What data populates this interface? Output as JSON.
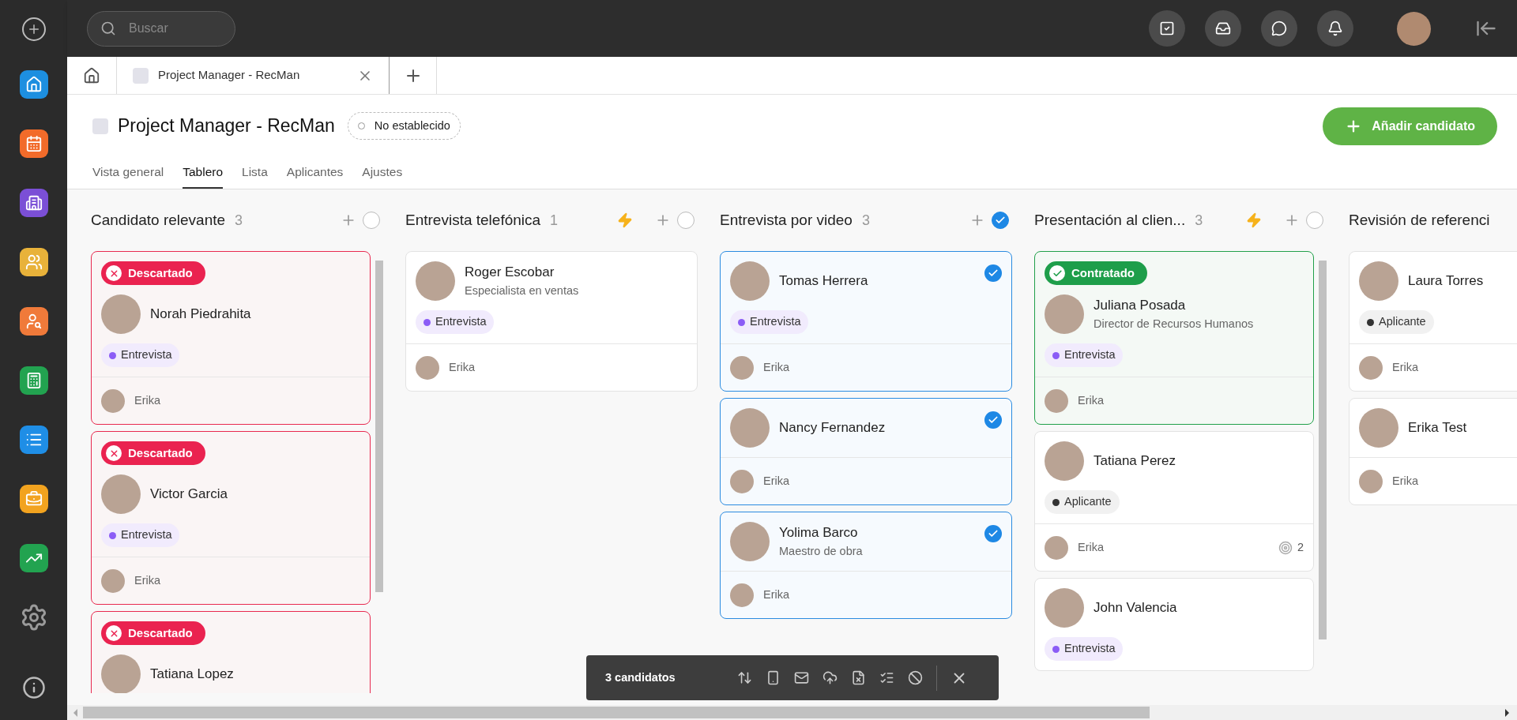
{
  "search": {
    "placeholder": "Buscar"
  },
  "doc_tabs": [
    {
      "label": "Project Manager - RecMan",
      "selected": true
    }
  ],
  "page": {
    "title": "Project Manager - RecMan",
    "status": "No establecido",
    "add_button": "Añadir candidato"
  },
  "tabs": [
    {
      "label": "Vista general",
      "selected": false
    },
    {
      "label": "Tablero",
      "selected": true
    },
    {
      "label": "Lista",
      "selected": false
    },
    {
      "label": "Aplicantes",
      "selected": false
    },
    {
      "label": "Ajustes",
      "selected": false
    }
  ],
  "columns": [
    {
      "title": "Candidato relevante",
      "count": "3",
      "automation": false,
      "all_selected": false,
      "cards": [
        {
          "name": "Norah Piedrahita",
          "badge": {
            "kind": "discarded",
            "label": "Descartado"
          },
          "tag": {
            "label": "Entrevista",
            "color": "#8b5cf6"
          },
          "owner": "Erika",
          "selected": false
        },
        {
          "name": "Victor Garcia",
          "badge": {
            "kind": "discarded",
            "label": "Descartado"
          },
          "tag": {
            "label": "Entrevista",
            "color": "#8b5cf6"
          },
          "owner": "Erika",
          "selected": false
        },
        {
          "name": "Tatiana Lopez",
          "badge": {
            "kind": "discarded",
            "label": "Descartado"
          },
          "selected": false
        }
      ]
    },
    {
      "title": "Entrevista telefónica",
      "count": "1",
      "automation": true,
      "all_selected": false,
      "cards": [
        {
          "name": "Roger Escobar",
          "subtitle": "Especialista en ventas",
          "tag": {
            "label": "Entrevista",
            "color": "#8b5cf6"
          },
          "owner": "Erika",
          "selected": false
        }
      ]
    },
    {
      "title": "Entrevista por video",
      "count": "3",
      "automation": false,
      "all_selected": true,
      "cards": [
        {
          "name": "Tomas Herrera",
          "tag": {
            "label": "Entrevista",
            "color": "#8b5cf6"
          },
          "owner": "Erika",
          "selected": true
        },
        {
          "name": "Nancy Fernandez",
          "owner": "Erika",
          "selected": true
        },
        {
          "name": "Yolima Barco",
          "subtitle": "Maestro de obra",
          "owner": "Erika",
          "selected": true
        }
      ]
    },
    {
      "title": "Presentación al clien...",
      "count": "3",
      "automation": true,
      "all_selected": false,
      "cards": [
        {
          "name": "Juliana Posada",
          "subtitle": "Director de Recursos Humanos",
          "badge": {
            "kind": "hired",
            "label": "Contratado"
          },
          "tag": {
            "label": "Entrevista",
            "color": "#8b5cf6"
          },
          "owner": "Erika",
          "selected": false
        },
        {
          "name": "Tatiana Perez",
          "tag": {
            "label": "Aplicante",
            "color": "#333333"
          },
          "owner": "Erika",
          "score": "2",
          "selected": false
        },
        {
          "name": "John Valencia",
          "tag": {
            "label": "Entrevista",
            "color": "#8b5cf6"
          },
          "selected": false
        }
      ]
    },
    {
      "title": "Revisión de referenci",
      "cards": [
        {
          "name": "Laura Torres",
          "tag": {
            "label": "Aplicante",
            "color": "#333333"
          },
          "owner": "Erika",
          "selected": false
        },
        {
          "name": "Erika Test",
          "owner": "Erika",
          "selected": false
        }
      ]
    }
  ],
  "selection_bar": {
    "label": "3 candidatos"
  }
}
